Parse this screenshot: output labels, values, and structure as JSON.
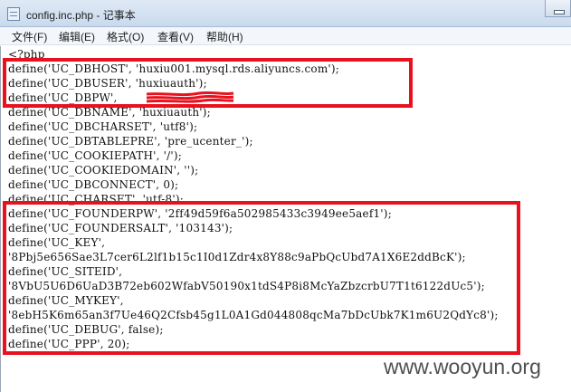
{
  "window": {
    "title": "config.inc.php - 记事本"
  },
  "menu": [
    {
      "label": "文件(F)"
    },
    {
      "label": "编辑(E)"
    },
    {
      "label": "格式(O)"
    },
    {
      "label": "查看(V)"
    },
    {
      "label": "帮助(H)"
    }
  ],
  "code_lines": [
    "<?php",
    "define('UC_DBHOST', 'huxiu001.mysql.rds.aliyuncs.com');",
    "define('UC_DBUSER', 'huxiuauth');",
    "define('UC_DBPW', ",
    "define('UC_DBNAME', 'huxiuauth');",
    "define('UC_DBCHARSET', 'utf8');",
    "define('UC_DBTABLEPRE', 'pre_ucenter_');",
    "define('UC_COOKIEPATH', '/');",
    "define('UC_COOKIEDOMAIN', '');",
    "define('UC_DBCONNECT', 0);",
    "define('UC_CHARSET', 'utf-8');",
    "define('UC_FOUNDERPW', '2ff49d59f6a502985433c3949ee5aef1');",
    "define('UC_FOUNDERSALT', '103143');",
    "define('UC_KEY',",
    "'8Pbj5e656Sae3L7cer6L2lf1b15c1I0d1Zdr4x8Y88c9aPbQcUbd7A1X6E2ddBcK');",
    "define('UC_SITEID',",
    "'8VbU5U6D6UaD3B72eb602WfabV50190x1tdS4P8i8McYaZbzcrbU7T1t6122dUc5');",
    "define('UC_MYKEY',",
    "'8ebH5K6m65an3f7Ue46Q2Cfsb45g1L0A1Gd044808qcMa7bDcUbk7K1m6U2QdYc8');",
    "define('UC_DEBUG', false);",
    "define('UC_PPP', 20);"
  ],
  "watermark": "www.wooyun.org",
  "colors": {
    "highlight": "#e8121e",
    "redaction": "#e8121e"
  }
}
